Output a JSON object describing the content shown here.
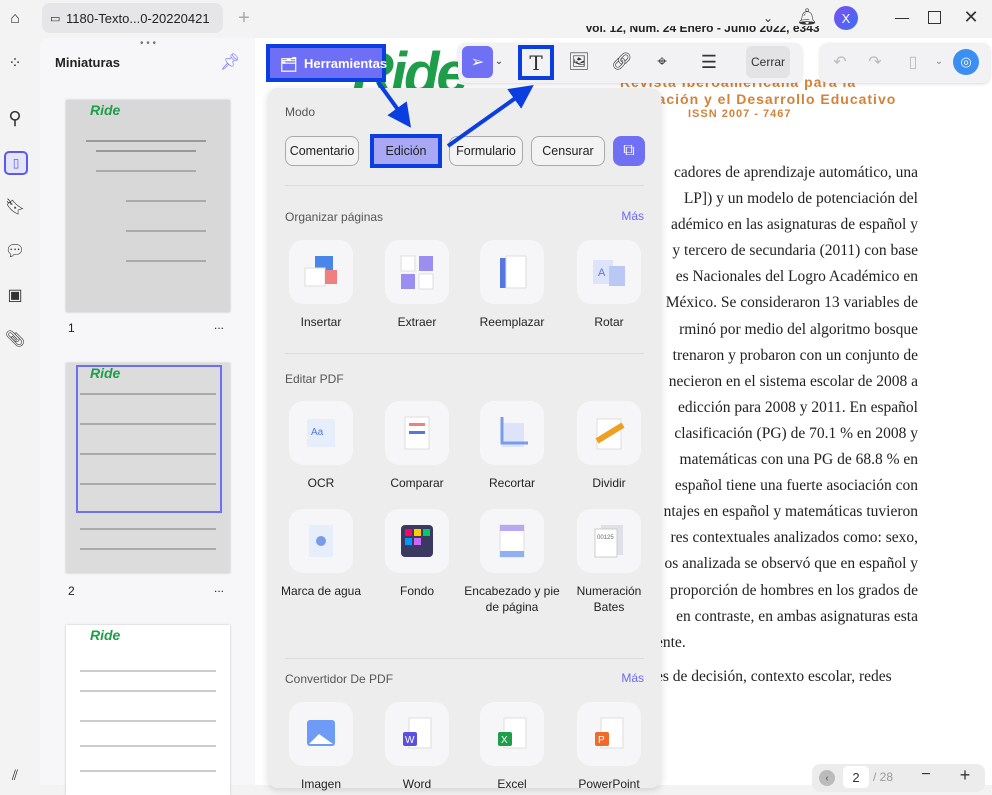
{
  "tabbar": {
    "tab_title": "1180-Texto...0-20220421",
    "avatar_letter": "X"
  },
  "thumbs": {
    "title": "Miniaturas",
    "pages": [
      "1",
      "2"
    ],
    "more": "..."
  },
  "tools": {
    "herramientas": "Herramientas",
    "cerrar": "Cerrar"
  },
  "panel": {
    "mode_title": "Modo",
    "modes": [
      "Comentario",
      "Edición",
      "Formulario",
      "Censurar"
    ],
    "organize_title": "Organizar páginas",
    "more": "Más",
    "organize": [
      "Insertar",
      "Extraer",
      "Reemplazar",
      "Rotar"
    ],
    "edit_title": "Editar PDF",
    "edit": [
      "OCR",
      "Comparar",
      "Recortar",
      "Dividir",
      "Marca de agua",
      "Fondo",
      "Encabezado y pie de página",
      "Numeración Bates"
    ],
    "convert_title": "Convertidor De PDF",
    "convert": [
      "Imagen",
      "Word",
      "Excel",
      "PowerPoint"
    ]
  },
  "document": {
    "header_line": "Vol. 12, Núm. 24 Enero - Junio 2022, e343",
    "journal_1": "Revista Iberoamericana para la",
    "journal_2": "gación y el Desarrollo Educativo",
    "issn": "ISSN 2007 - 7467",
    "logo": "Ride",
    "lines": [
      "cadores de aprendizaje automático, una",
      "LP]) y un modelo de potenciación del",
      "adémico en las asignaturas de español y",
      "y tercero de secundaria (2011) con base",
      "es Nacionales del Logro Académico en",
      "México. Se consideraron 13 variables de",
      "rminó por medio del algoritmo bosque",
      "trenaron y probaron con un conjunto de",
      "necieron en el sistema escolar de 2008 a",
      "edicción para 2008 y 2011. En español",
      "clasificación (PG) de 70.1 % en 2008 y",
      "matemáticas con una PG de 68.8 % en",
      "español tiene una fuerte asociación con",
      "ntajes en español y matemáticas tuvieron",
      "res contextuales analizados como: sexo,",
      "os analizada se observó que en español y",
      "proporción de hombres en los grados de",
      "en contraste, en ambas asignaturas esta",
      "ente.",
      "es de decisión, contexto escolar, redes"
    ]
  },
  "pagenav": {
    "current": "2",
    "total": "/ 28"
  },
  "colors": {
    "accent": "#6f6ff5",
    "annotation": "#0a3ee0"
  }
}
